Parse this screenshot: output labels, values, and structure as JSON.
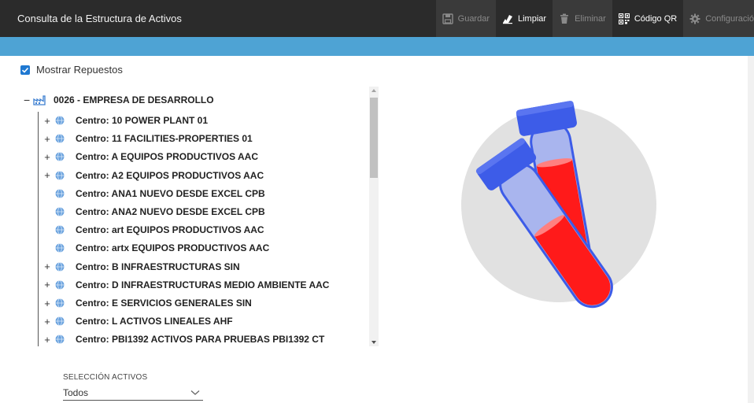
{
  "app": {
    "title": "Consulta de la Estructura de Activos"
  },
  "toolbar": [
    {
      "label": "Guardar",
      "icon": "save-icon",
      "enabled": false
    },
    {
      "label": "Limpiar",
      "icon": "eraser-icon",
      "enabled": true
    },
    {
      "label": "Eliminar",
      "icon": "trash-icon",
      "enabled": false
    },
    {
      "label": "Código QR",
      "icon": "qr-code-icon",
      "enabled": true
    },
    {
      "label": "Configuració",
      "icon": "gear-icon",
      "enabled": false
    }
  ],
  "options": {
    "show_spares_label": "Mostrar Repuestos",
    "show_spares_checked": true
  },
  "tree": {
    "root": "0026 - EMPRESA DE DESARROLLO",
    "items": [
      {
        "label": "Centro: 10 POWER PLANT 01",
        "expandable": true
      },
      {
        "label": "Centro: 11 FACILITIES-PROPERTIES 01",
        "expandable": true
      },
      {
        "label": "Centro: A EQUIPOS PRODUCTIVOS AAC",
        "expandable": true
      },
      {
        "label": "Centro: A2 EQUIPOS PRODUCTIVOS AAC",
        "expandable": true
      },
      {
        "label": "Centro: ANA1 NUEVO DESDE EXCEL CPB",
        "expandable": false
      },
      {
        "label": "Centro: ANA2 NUEVO DESDE EXCEL CPB",
        "expandable": false
      },
      {
        "label": "Centro: art EQUIPOS PRODUCTIVOS AAC",
        "expandable": false
      },
      {
        "label": "Centro: artx EQUIPOS PRODUCTIVOS AAC",
        "expandable": false
      },
      {
        "label": "Centro: B INFRAESTRUCTURAS SIN",
        "expandable": true
      },
      {
        "label": "Centro: D INFRAESTRUCTURAS MEDIO AMBIENTE AAC",
        "expandable": true
      },
      {
        "label": "Centro: E SERVICIOS GENERALES SIN",
        "expandable": true
      },
      {
        "label": "Centro: L ACTIVOS LINEALES AHF",
        "expandable": true
      },
      {
        "label": "Centro: PBI1392 ACTIVOS PARA PRUEBAS PBI1392 CT",
        "expandable": true
      }
    ]
  },
  "selection": {
    "label": "SELECCIÓN ACTIVOS",
    "value": "Todos"
  },
  "colors": {
    "topbar": "#2b2b2b",
    "band": "#4ea3d4",
    "checkbox": "#1f78d1",
    "tube_cap": "#3d5ce8",
    "liquid": "#ff1a1a"
  }
}
